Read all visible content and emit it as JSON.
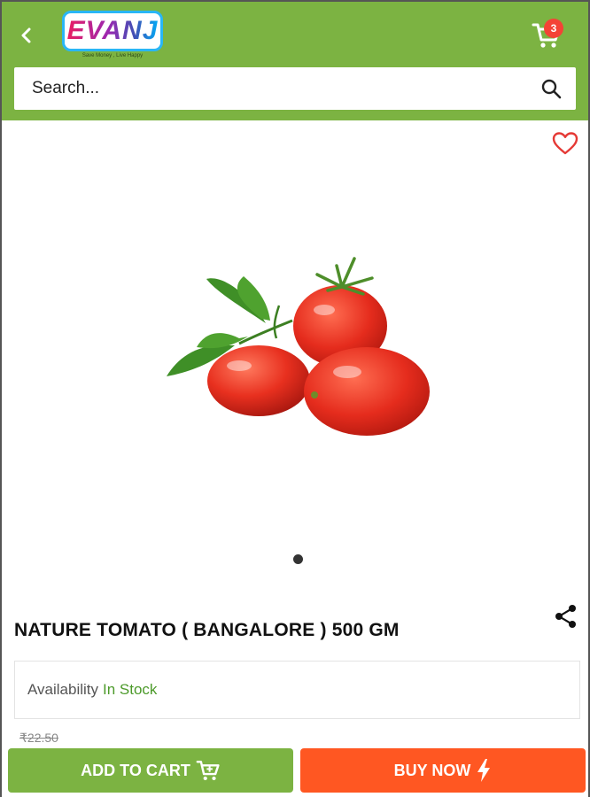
{
  "header": {
    "logo_text": "EVANJ",
    "logo_tagline": "Save Money , Live Happy",
    "cart_count": "3",
    "bg_color": "#7cb342"
  },
  "search": {
    "placeholder": "Search..."
  },
  "product": {
    "title": "NATURE TOMATO ( BANGALORE ) 500 GM",
    "availability_label": "Availability",
    "availability_status": "In Stock",
    "old_price": "₹22.50",
    "image_icon": "tomato-image",
    "carousel_dots": 1
  },
  "actions": {
    "add_to_cart_label": "ADD TO CART",
    "buy_now_label": "BUY NOW",
    "add_to_cart_color": "#7cb342",
    "buy_now_color": "#ff5722"
  },
  "icons": {
    "back": "chevron-left-icon",
    "cart": "cart-icon",
    "search": "search-icon",
    "wishlist": "heart-icon",
    "share": "share-icon",
    "bolt": "lightning-icon"
  }
}
